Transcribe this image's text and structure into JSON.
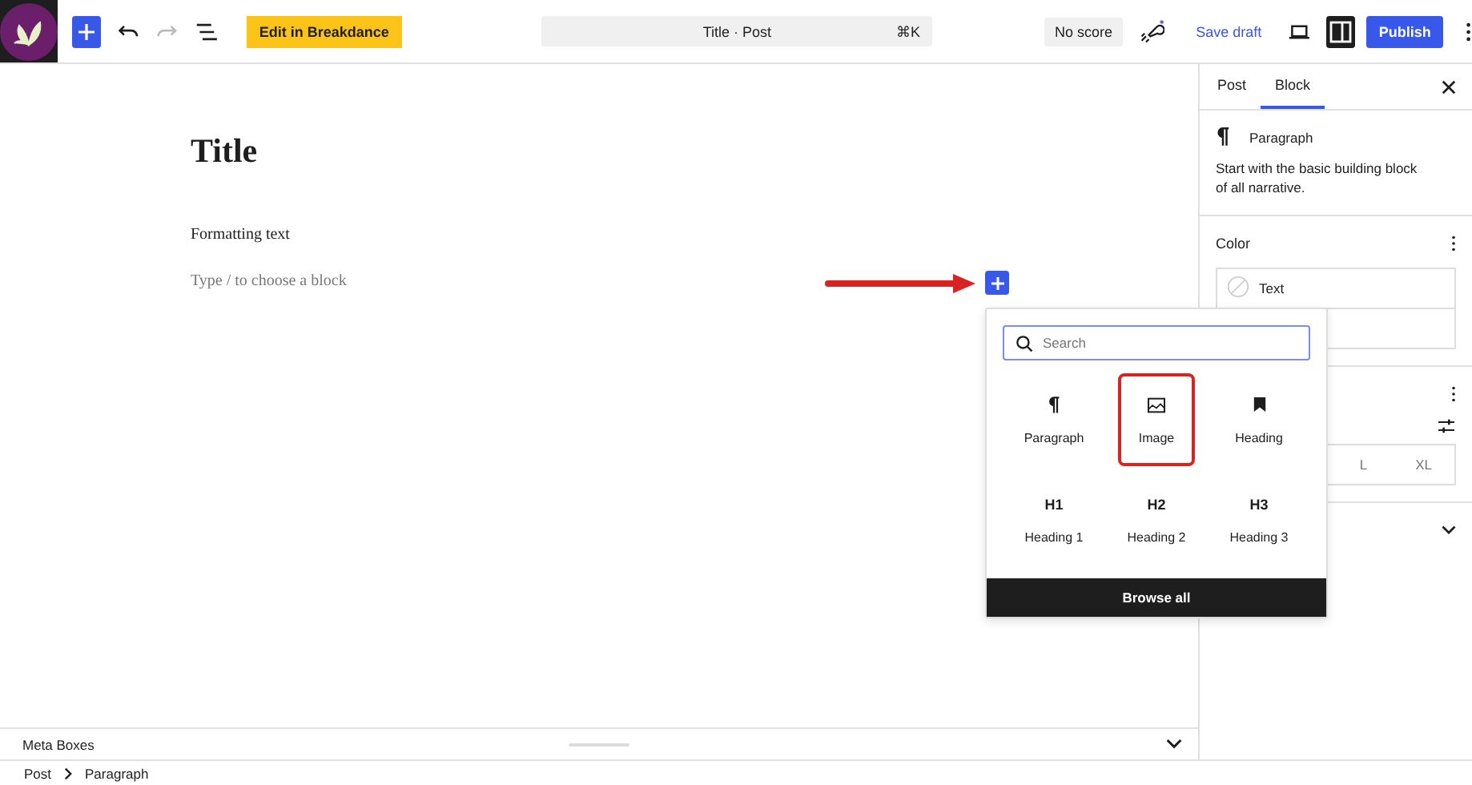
{
  "toolbar": {
    "edit_button": "Edit in Breakdance",
    "command": {
      "title": "Title · Post",
      "shortcut": "⌘K"
    },
    "score": "No score",
    "save_draft": "Save draft",
    "publish": "Publish",
    "sidebar_toggle_on": true
  },
  "editor": {
    "title": "Title",
    "paragraph": "Formatting text",
    "placeholder": "Type / to choose a block"
  },
  "inserter": {
    "search_placeholder": "Search",
    "blocks": [
      {
        "label": "Paragraph",
        "kind": "paragraph",
        "highlighted": false
      },
      {
        "label": "Image",
        "kind": "image",
        "highlighted": true
      },
      {
        "label": "Heading",
        "kind": "heading",
        "highlighted": false
      },
      {
        "label": "Heading 1",
        "kind": "level",
        "icon_text": "H1",
        "highlighted": false
      },
      {
        "label": "Heading 2",
        "kind": "level",
        "icon_text": "H2",
        "highlighted": false
      },
      {
        "label": "Heading 3",
        "kind": "level",
        "icon_text": "H3",
        "highlighted": false
      }
    ],
    "browse_all": "Browse all"
  },
  "sidebar": {
    "tabs": [
      {
        "label": "Post",
        "selected": false
      },
      {
        "label": "Block",
        "selected": true
      }
    ],
    "block": {
      "name": "Paragraph",
      "description": "Start with the basic building block of all narrative."
    },
    "color": {
      "title": "Color",
      "items": [
        "Text"
      ]
    },
    "sizes": [
      "L",
      "XL"
    ]
  },
  "meta_boxes": "Meta Boxes",
  "breadcrumb": [
    "Post",
    "Paragraph"
  ]
}
